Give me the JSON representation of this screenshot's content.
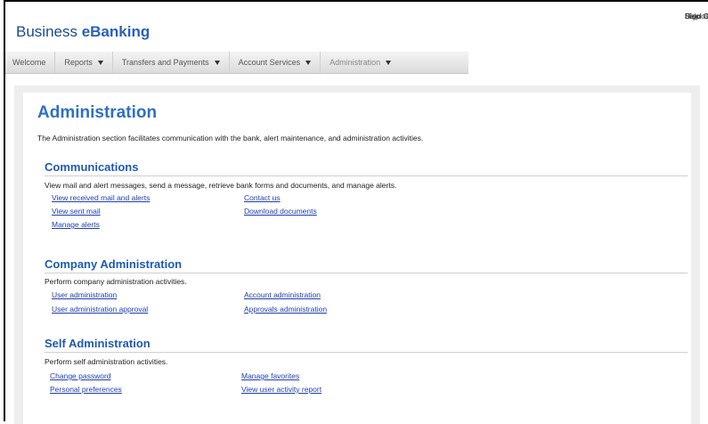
{
  "header": {
    "brand_regular": "Business ",
    "brand_bold": "eBanking",
    "util_links": {
      "disclosures": "Disclosures",
      "separator": "|",
      "help": "Help",
      "sign_off": "Sign Off"
    }
  },
  "nav": {
    "items": [
      {
        "label": "Welcome",
        "has_dropdown": false
      },
      {
        "label": "Reports",
        "has_dropdown": true
      },
      {
        "label": "Transfers and Payments",
        "has_dropdown": true
      },
      {
        "label": "Account Services",
        "has_dropdown": true
      },
      {
        "label": "Administration",
        "has_dropdown": true
      }
    ]
  },
  "main": {
    "title": "Administration",
    "intro": "The Administration section facilitates communication with the bank, alert maintenance, and administration activities.",
    "sections": [
      {
        "title": "Communications",
        "description": "View mail and alert messages, send a message, retrieve bank forms and documents, and manage alerts.",
        "links_left": [
          "View received mail and alerts",
          "View sent mail",
          "Manage alerts"
        ],
        "links_right": [
          "Contact us",
          "Download documents"
        ]
      },
      {
        "title": "Company Administration",
        "description": "Perform company administration activities.",
        "links_left": [
          "User administration",
          "User administration approval"
        ],
        "links_right": [
          "Account administration",
          "Approvals administration"
        ]
      },
      {
        "title": "Self Administration",
        "description": "Perform self administration activities.",
        "links_left": [
          "Change password",
          "Personal preferences"
        ],
        "links_right": [
          "Manage favorites",
          "View user activity report"
        ]
      }
    ]
  },
  "colors": {
    "title_blue": "#2f6fc7",
    "section_blue": "#1d5ab4",
    "link_blue": "#1f3fae",
    "panel_gray": "#eeeeee"
  },
  "icons": {
    "dropdown": "chevron-down-icon"
  }
}
